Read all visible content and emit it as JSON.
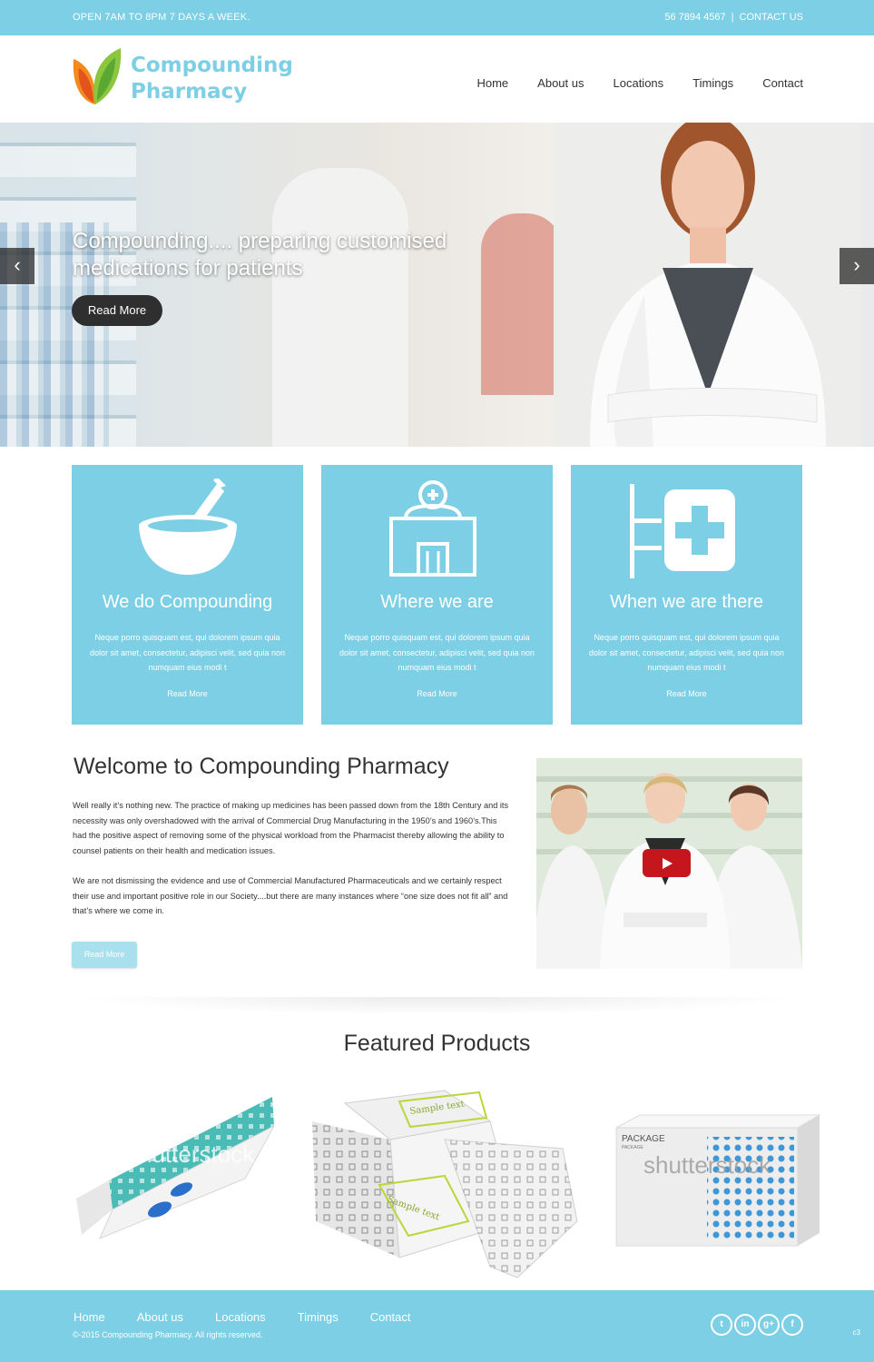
{
  "colors": {
    "accent": "#7ccfe4",
    "dark_button": "#2f2f2f",
    "video_play": "#c4161c"
  },
  "topbar": {
    "hours": "OPEN 7AM TO 8PM 7 DAYS A WEEK.",
    "phone": "56 7894 4567",
    "separator": "|",
    "contact": "CONTACT US"
  },
  "logo": {
    "line1": "Compounding",
    "line2": "Pharmacy",
    "icon": "leaf-icon"
  },
  "nav": [
    "Home",
    "About us",
    "Locations",
    "Timings",
    "Contact"
  ],
  "hero": {
    "title": "Compounding.... preparing customised medications for patients",
    "button": "Read More",
    "prev_icon": "chevron-left-icon",
    "next_icon": "chevron-right-icon"
  },
  "features": [
    {
      "icon": "mortar-pestle-icon",
      "title": "We do Compounding",
      "text": "Neque porro quisquam est, qui dolorem ipsum quia dolor sit amet, consectetur, adipisci velit, sed quia non numquam eius modi t",
      "more": "Read More"
    },
    {
      "icon": "pharmacy-building-icon",
      "title": "Where we are",
      "text": "Neque porro quisquam est, qui dolorem ipsum quia dolor sit amet, consectetur, adipisci velit, sed quia non numquam eius modi t",
      "more": "Read More"
    },
    {
      "icon": "pharmacy-sign-icon",
      "title": "When we are there",
      "text": "Neque porro quisquam est, qui dolorem ipsum quia dolor sit amet, consectetur, adipisci velit, sed quia non numquam eius modi t",
      "more": "Read More"
    }
  ],
  "welcome": {
    "title": "Welcome to Compounding Pharmacy",
    "p1": "Well really it’s nothing new. The practice of making up medicines has been passed down from the 18th Century and its necessity was only overshadowed with the arrival of Commercial Drug Manufacturing in the 1950’s and 1960’s.This had the positive aspect of removing some of the physical workload from the Pharmacist thereby allowing the ability to counsel patients on their health and medication issues.",
    "p2": "We are not dismissing the evidence and use of Commercial Manufactured Pharmaceuticals and we certainly respect their use and important positive role in our Society....but there are many instances where “one size does not fit all” and that’s where we come in.",
    "button": "Read More",
    "video_icon": "play-icon"
  },
  "products": {
    "title": "Featured Products",
    "items": [
      {
        "watermark": "shutterstock"
      },
      {
        "label_top": "Sample text",
        "label_bottom": "Sample text"
      },
      {
        "label": "PACKAGE",
        "sublabel": "PACKAGE",
        "watermark": "shutterstock"
      }
    ]
  },
  "footer": {
    "nav": [
      "Home",
      "About us",
      "Locations",
      "Timings",
      "Contact"
    ],
    "copyright": "©-2015 Compounding Pharmacy. All rights reserved.",
    "social": [
      {
        "icon": "twitter-icon",
        "glyph": "t"
      },
      {
        "icon": "linkedin-icon",
        "glyph": "in"
      },
      {
        "icon": "google-plus-icon",
        "glyph": "g+"
      },
      {
        "icon": "facebook-icon",
        "glyph": "f"
      }
    ],
    "credit": "c3"
  }
}
